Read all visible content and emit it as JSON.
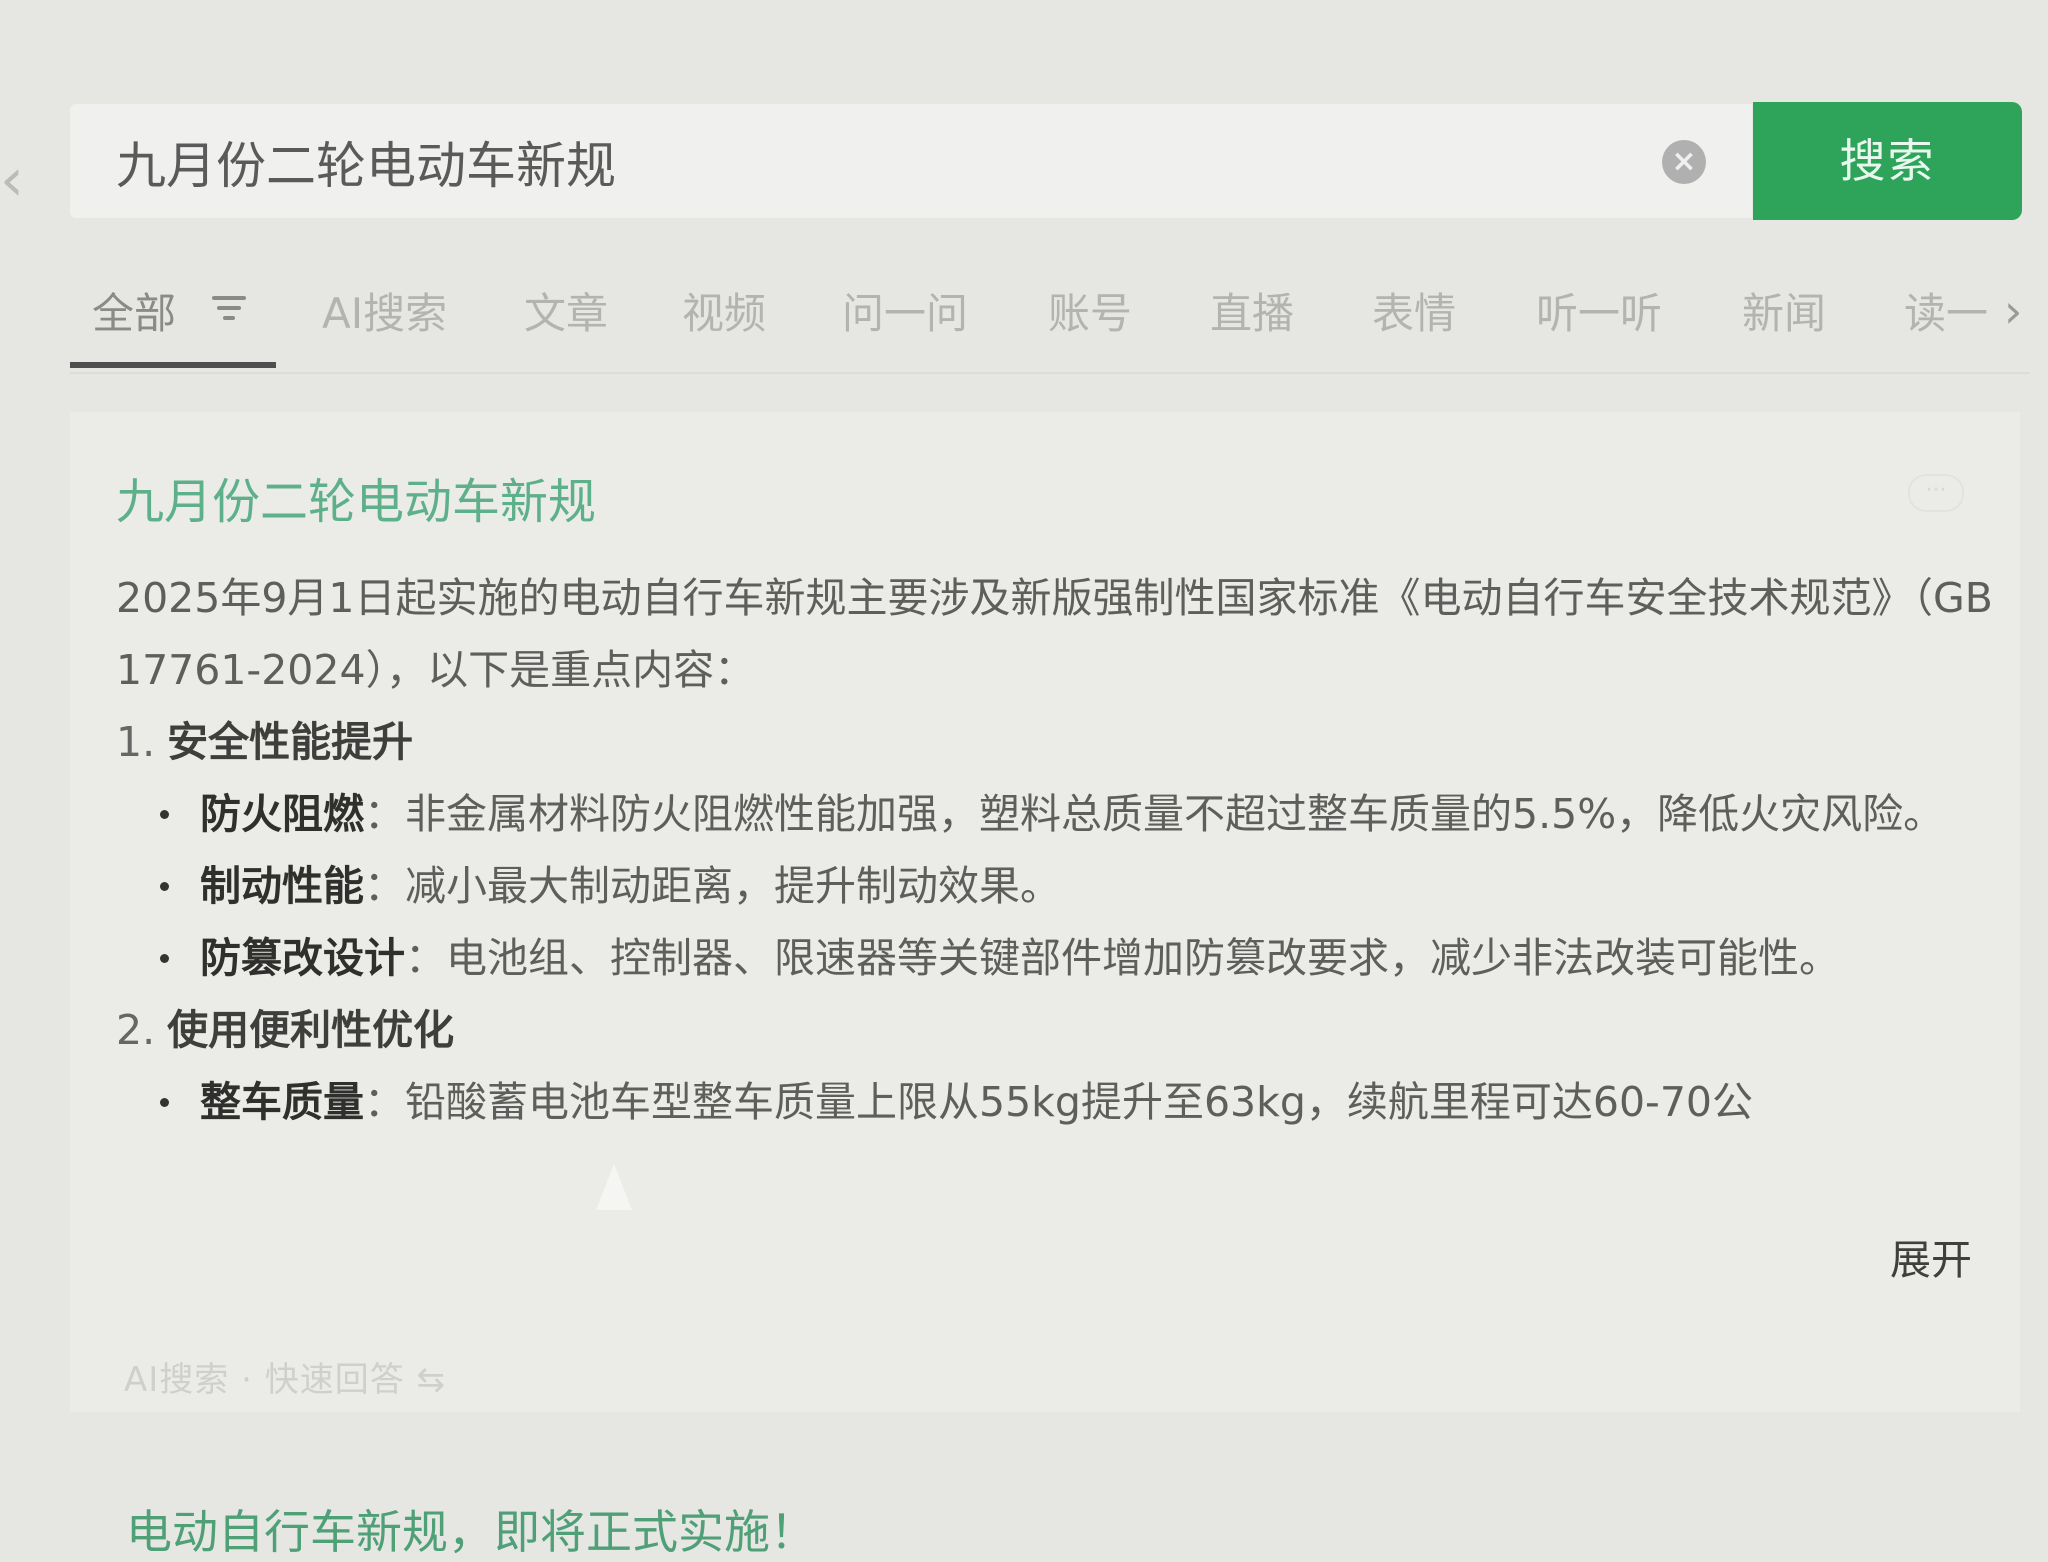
{
  "search": {
    "query": "九月份二轮电动车新规",
    "button_label": "搜索"
  },
  "tabs": [
    {
      "label": "全部",
      "active": true
    },
    {
      "label": "AI搜索"
    },
    {
      "label": "文章"
    },
    {
      "label": "视频"
    },
    {
      "label": "问一问"
    },
    {
      "label": "账号"
    },
    {
      "label": "直播"
    },
    {
      "label": "表情"
    },
    {
      "label": "听一听"
    },
    {
      "label": "新闻"
    },
    {
      "label": "读一"
    }
  ],
  "result": {
    "title": "九月份二轮电动车新规",
    "intro": "2025年9月1日起实施的电动自行车新规主要涉及新版强制性国家标准《电动自行车安全技术规范》（GB 17761-2024），以下是重点内容：",
    "section1": {
      "number": "1.",
      "title": "安全性能提升",
      "items": [
        {
          "term": "防火阻燃",
          "text": "：非金属材料防火阻燃性能加强，塑料总质量不超过整车质量的5.5%，降低火灾风险。"
        },
        {
          "term": "制动性能",
          "text": "：减小最大制动距离，提升制动效果。"
        },
        {
          "term": "防篡改设计",
          "text": "：电池组、控制器、限速器等关键部件增加防篡改要求，减少非法改装可能性。"
        }
      ]
    },
    "section2": {
      "number": "2.",
      "title": "使用便利性优化",
      "items": [
        {
          "term": "整车质量",
          "text": "：铅酸蓄电池车型整车质量上限从55kg提升至63kg，续航里程可达60-70公"
        }
      ]
    },
    "expand_label": "展开",
    "footer": "AI搜索 · 快速回答 ⇆"
  },
  "next_result": {
    "title": "电动自行车新规，即将正式实施！"
  },
  "colors": {
    "accent_green": "#2ea35a",
    "title_green": "#5db08a"
  }
}
